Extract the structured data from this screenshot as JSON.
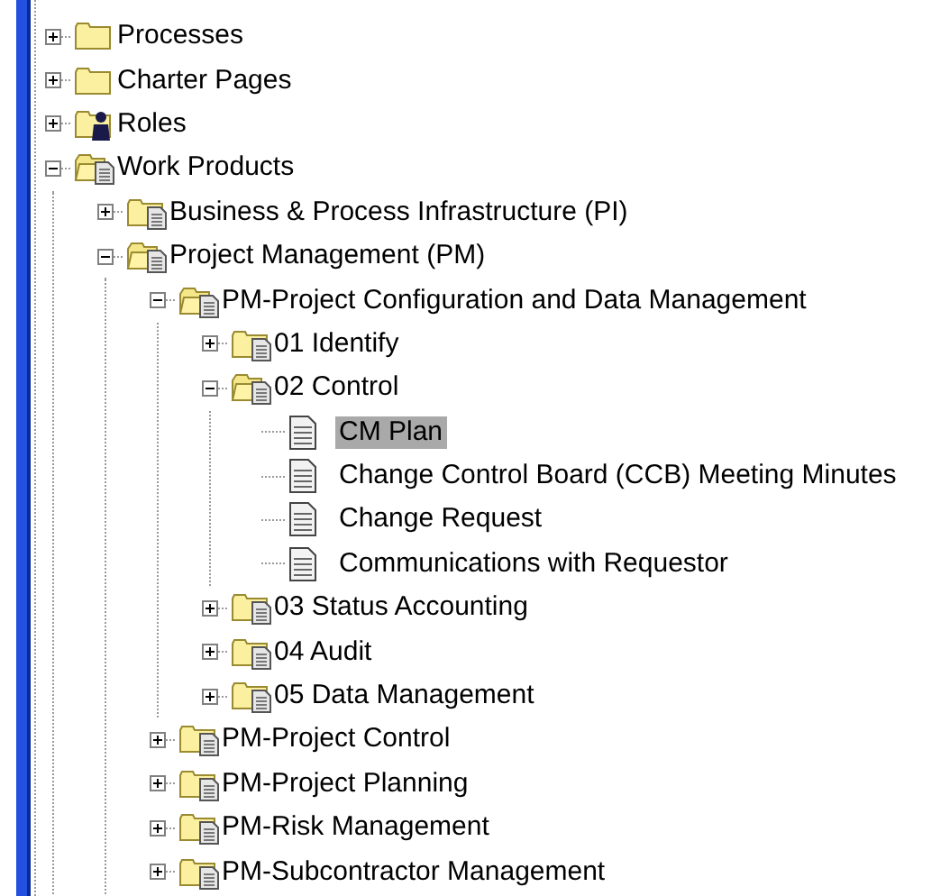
{
  "tree": [
    {
      "label": "Processes",
      "kind": "folder",
      "expanded": false
    },
    {
      "label": "Charter Pages",
      "kind": "folder",
      "expanded": false
    },
    {
      "label": "Roles",
      "kind": "roles",
      "expanded": false
    },
    {
      "label": "Work Products",
      "kind": "docfolder",
      "expanded": true,
      "children": [
        {
          "label": "Business & Process Infrastructure (PI)",
          "kind": "docfolder",
          "expanded": false
        },
        {
          "label": "Project Management (PM)",
          "kind": "docfolder",
          "expanded": true,
          "children": [
            {
              "label": "PM-Project Configuration and Data Management",
              "kind": "docfolder",
              "expanded": true,
              "children": [
                {
                  "label": "01 Identify",
                  "kind": "docfolder",
                  "expanded": false
                },
                {
                  "label": "02 Control",
                  "kind": "docfolder",
                  "expanded": true,
                  "children": [
                    {
                      "label": "CM Plan",
                      "kind": "document",
                      "selected": true
                    },
                    {
                      "label": "Change Control Board (CCB) Meeting Minutes",
                      "kind": "document",
                      "selected": false
                    },
                    {
                      "label": "Change Request",
                      "kind": "document",
                      "selected": false
                    },
                    {
                      "label": "Communications with Requestor",
                      "kind": "document",
                      "selected": false
                    }
                  ]
                },
                {
                  "label": "03 Status Accounting",
                  "kind": "docfolder",
                  "expanded": false
                },
                {
                  "label": "04 Audit",
                  "kind": "docfolder",
                  "expanded": false
                },
                {
                  "label": "05 Data Management",
                  "kind": "docfolder",
                  "expanded": false
                }
              ]
            },
            {
              "label": "PM-Project Control",
              "kind": "docfolder",
              "expanded": false
            },
            {
              "label": "PM-Project Planning",
              "kind": "docfolder",
              "expanded": false
            },
            {
              "label": "PM-Risk Management",
              "kind": "docfolder",
              "expanded": false
            },
            {
              "label": "PM-Subcontractor Management",
              "kind": "docfolder",
              "expanded": false
            }
          ]
        }
      ]
    }
  ]
}
